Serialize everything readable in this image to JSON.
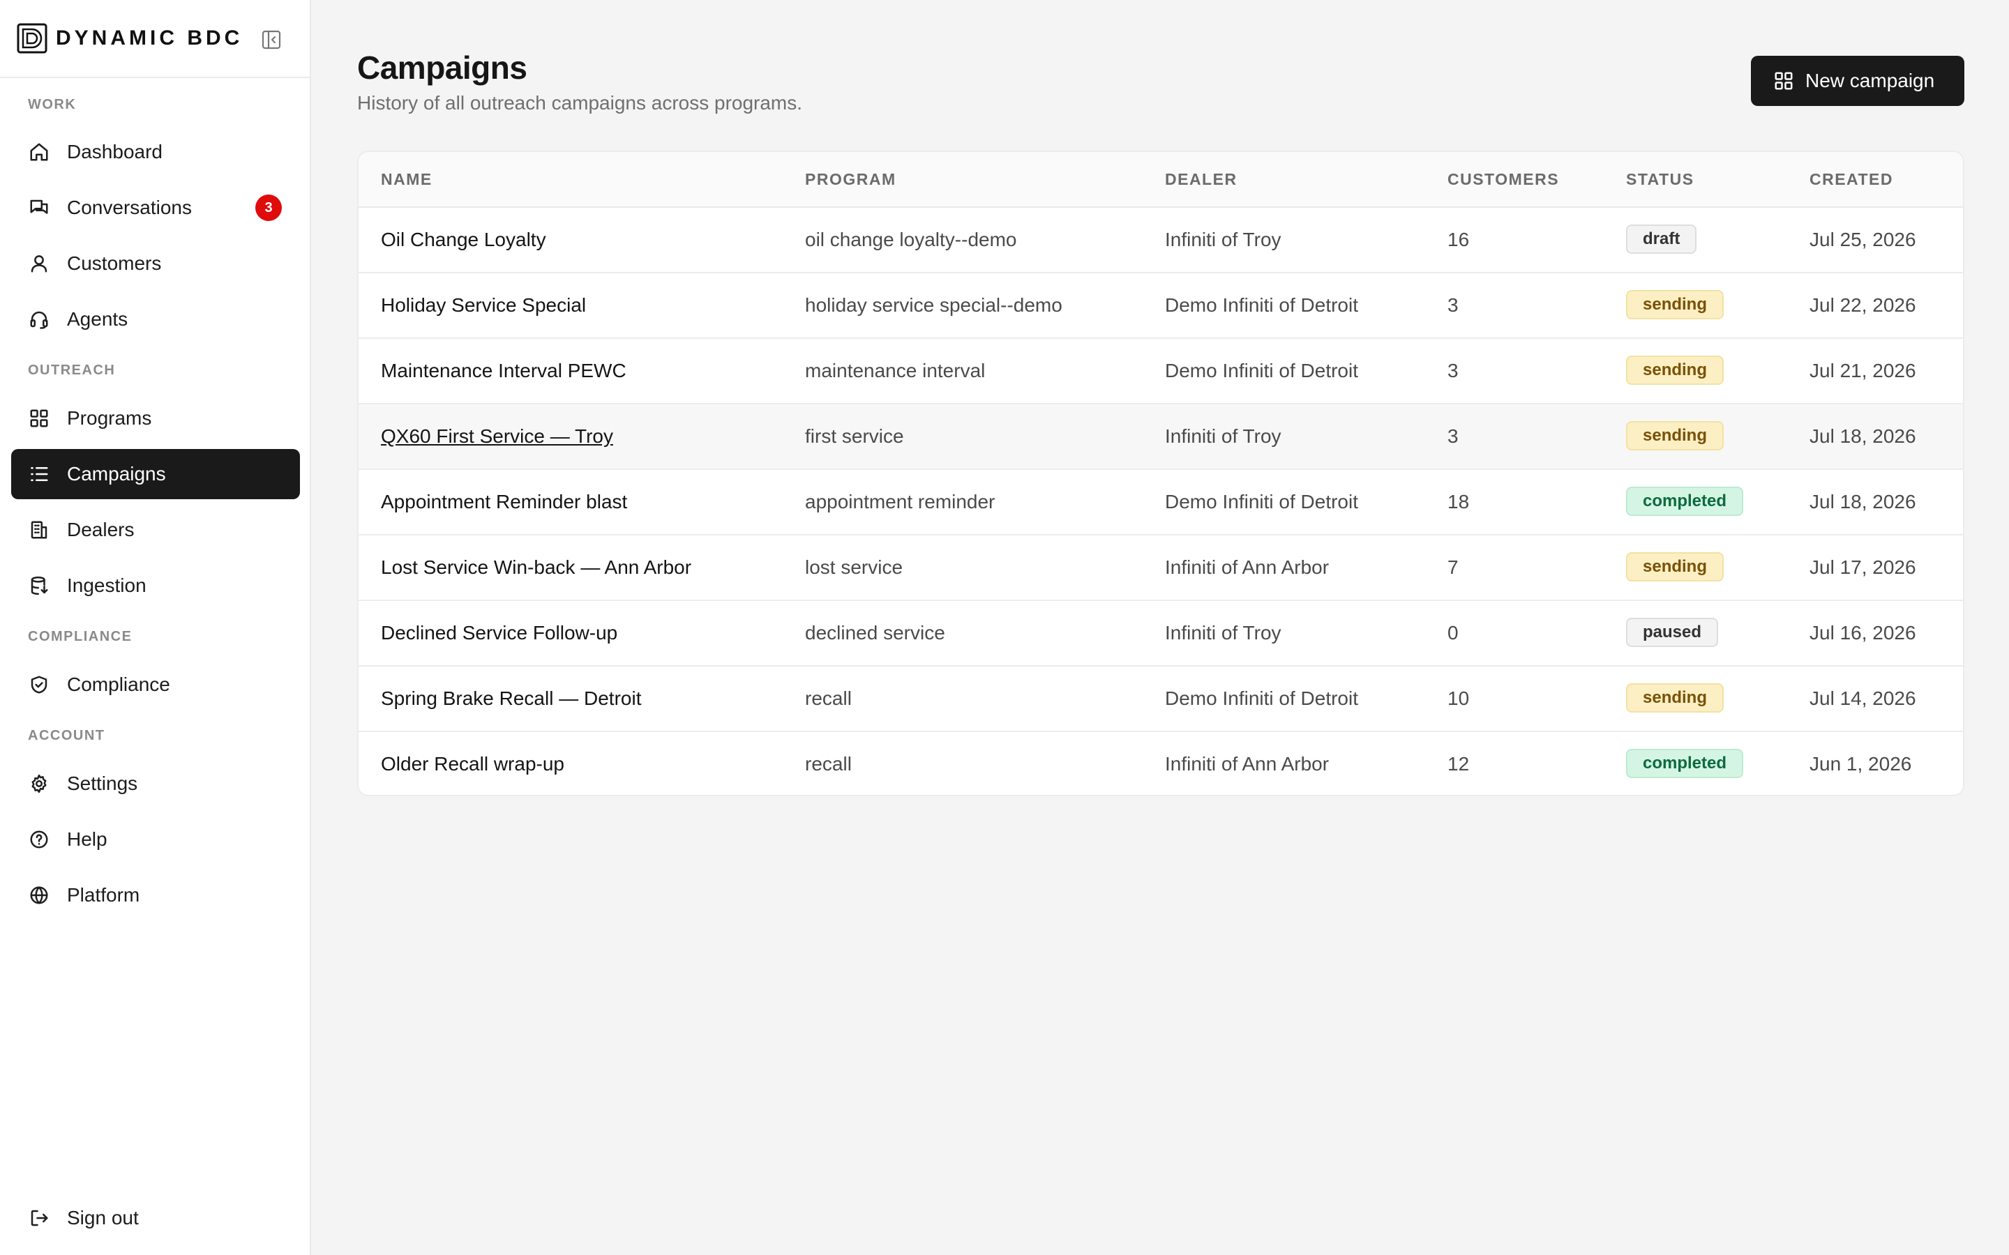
{
  "brand": {
    "name": "DYNAMIC BDC"
  },
  "sidebar": {
    "sections": {
      "work": "WORK",
      "outreach": "OUTREACH",
      "compliance": "COMPLIANCE",
      "account": "ACCOUNT"
    },
    "items": [
      {
        "label": "Dashboard",
        "icon": "home-icon"
      },
      {
        "label": "Conversations",
        "icon": "chat-icon",
        "badge": "3"
      },
      {
        "label": "Customers",
        "icon": "user-icon"
      },
      {
        "label": "Agents",
        "icon": "headset-icon"
      },
      {
        "label": "Programs",
        "icon": "grid-icon"
      },
      {
        "label": "Campaigns",
        "icon": "list-icon",
        "active": true
      },
      {
        "label": "Dealers",
        "icon": "building-icon"
      },
      {
        "label": "Ingestion",
        "icon": "database-icon"
      },
      {
        "label": "Compliance",
        "icon": "shield-icon"
      },
      {
        "label": "Settings",
        "icon": "gear-icon"
      },
      {
        "label": "Help",
        "icon": "help-icon"
      },
      {
        "label": "Platform",
        "icon": "globe-icon"
      }
    ],
    "signout": "Sign out"
  },
  "header": {
    "title": "Campaigns",
    "subtitle": "History of all outreach campaigns across programs.",
    "new_button": "New campaign"
  },
  "table": {
    "columns": [
      "NAME",
      "PROGRAM",
      "DEALER",
      "CUSTOMERS",
      "STATUS",
      "CREATED"
    ],
    "rows": [
      {
        "name": "Oil Change Loyalty",
        "program": "oil change loyalty--demo",
        "dealer": "Infiniti of Troy",
        "customers": "16",
        "status": "draft",
        "created": "Jul 25, 2026"
      },
      {
        "name": "Holiday Service Special",
        "program": "holiday service special--demo",
        "dealer": "Demo Infiniti of Detroit",
        "customers": "3",
        "status": "sending",
        "created": "Jul 22, 2026"
      },
      {
        "name": "Maintenance Interval PEWC",
        "program": "maintenance interval",
        "dealer": "Demo Infiniti of Detroit",
        "customers": "3",
        "status": "sending",
        "created": "Jul 21, 2026"
      },
      {
        "name": "QX60 First Service — Troy",
        "program": "first service",
        "dealer": "Infiniti of Troy",
        "customers": "3",
        "status": "sending",
        "created": "Jul 18, 2026"
      },
      {
        "name": "Appointment Reminder blast",
        "program": "appointment reminder",
        "dealer": "Demo Infiniti of Detroit",
        "customers": "18",
        "status": "completed",
        "created": "Jul 18, 2026"
      },
      {
        "name": "Lost Service Win-back — Ann Arbor",
        "program": "lost service",
        "dealer": "Infiniti of Ann Arbor",
        "customers": "7",
        "status": "sending",
        "created": "Jul 17, 2026"
      },
      {
        "name": "Declined Service Follow-up",
        "program": "declined service",
        "dealer": "Infiniti of Troy",
        "customers": "0",
        "status": "paused",
        "created": "Jul 16, 2026"
      },
      {
        "name": "Spring Brake Recall — Detroit",
        "program": "recall",
        "dealer": "Demo Infiniti of Detroit",
        "customers": "10",
        "status": "sending",
        "created": "Jul 14, 2026"
      },
      {
        "name": "Older Recall wrap-up",
        "program": "recall",
        "dealer": "Infiniti of Ann Arbor",
        "customers": "12",
        "status": "completed",
        "created": "Jun 1, 2026"
      }
    ]
  },
  "colors": {
    "accent": "#1a1a1a",
    "badge": "#e00b0b",
    "sending_bg": "#fcefc4",
    "completed_bg": "#d5f5e4"
  }
}
